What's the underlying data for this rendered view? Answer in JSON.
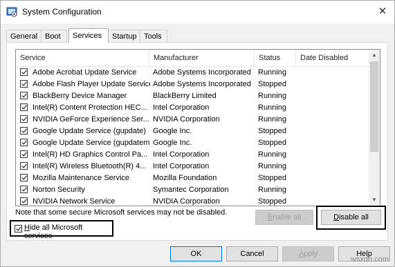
{
  "window": {
    "title": "System Configuration",
    "close_glyph": "✕"
  },
  "tabs": [
    {
      "label": "General",
      "active": false
    },
    {
      "label": "Boot",
      "active": false
    },
    {
      "label": "Services",
      "active": true
    },
    {
      "label": "Startup",
      "active": false
    },
    {
      "label": "Tools",
      "active": false
    }
  ],
  "columns": {
    "service": "Service",
    "manufacturer": "Manufacturer",
    "status": "Status",
    "date_disabled": "Date Disabled"
  },
  "services": [
    {
      "name": "Adobe Acrobat Update Service",
      "manufacturer": "Adobe Systems Incorporated",
      "status": "Running",
      "checked": true
    },
    {
      "name": "Adobe Flash Player Update Service",
      "manufacturer": "Adobe Systems Incorporated",
      "status": "Stopped",
      "checked": true
    },
    {
      "name": "BlackBerry Device Manager",
      "manufacturer": "BlackBerry Limited",
      "status": "Running",
      "checked": true
    },
    {
      "name": "Intel(R) Content Protection HEC...",
      "manufacturer": "Intel Corporation",
      "status": "Running",
      "checked": true
    },
    {
      "name": "NVIDIA GeForce Experience Ser...",
      "manufacturer": "NVIDIA Corporation",
      "status": "Running",
      "checked": true
    },
    {
      "name": "Google Update Service (gupdate)",
      "manufacturer": "Google Inc.",
      "status": "Stopped",
      "checked": true
    },
    {
      "name": "Google Update Service (gupdatem)",
      "manufacturer": "Google Inc.",
      "status": "Stopped",
      "checked": true
    },
    {
      "name": "Intel(R) HD Graphics Control Pa...",
      "manufacturer": "Intel Corporation",
      "status": "Running",
      "checked": true
    },
    {
      "name": "Intel(R) Wireless Bluetooth(R) 4...",
      "manufacturer": "Intel Corporation",
      "status": "Running",
      "checked": true
    },
    {
      "name": "Mozilla Maintenance Service",
      "manufacturer": "Mozilla Foundation",
      "status": "Stopped",
      "checked": true
    },
    {
      "name": "Norton Security",
      "manufacturer": "Symantec Corporation",
      "status": "Running",
      "checked": true
    },
    {
      "name": "NVIDIA Network Service",
      "manufacturer": "NVIDIA Corporation",
      "status": "Stopped",
      "checked": true
    }
  ],
  "scrollbar": {
    "up_glyph": "▲",
    "down_glyph": "▼"
  },
  "note": "Note that some secure Microsoft services may not be disabled.",
  "hide_ms": {
    "label_key": "H",
    "label_rest": "ide all Microsoft services",
    "checked": true
  },
  "buttons": {
    "enable_all_key": "E",
    "enable_all_rest": "nable all",
    "disable_all_key": "D",
    "disable_all_rest": "isable all",
    "ok": "OK",
    "cancel": "Cancel",
    "apply_key": "A",
    "apply_rest": "pply",
    "help": "Help"
  },
  "watermark": "wsxdn.com"
}
